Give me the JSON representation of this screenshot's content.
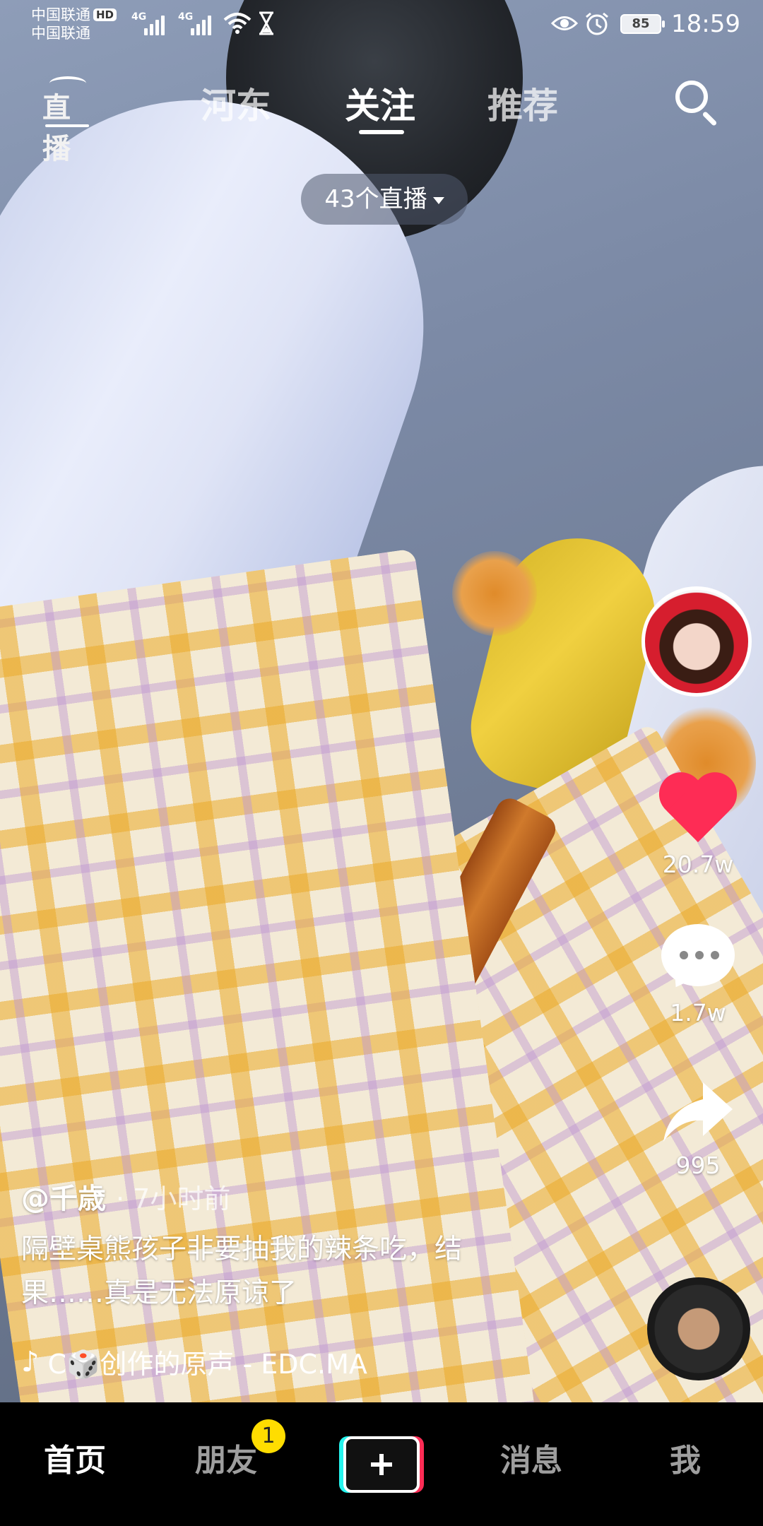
{
  "status_bar": {
    "carrier_1": "中国联通",
    "carrier_2": "中国联通",
    "hd_label": "HD",
    "network_1": "4G",
    "network_2": "4G",
    "battery": "85",
    "time": "18:59"
  },
  "top_tabs": {
    "live_label": "直播",
    "items": [
      "河东",
      "关注",
      "推荐"
    ],
    "active": "关注"
  },
  "live_pill": {
    "label": "43个直播"
  },
  "actions": {
    "like_count": "20.7w",
    "comment_count": "1.7w",
    "share_count": "995"
  },
  "post": {
    "author": "@千歳",
    "time": "· 7小时前",
    "description_line1": "隔壁桌熊孩子非要抽我的辣条吃，结",
    "description_line2": "果……真是无法原谅了",
    "music": "C🎲创作的原声 - EDC.MA"
  },
  "bottom_tabs": {
    "home": "首页",
    "friends": "朋友",
    "friends_badge": "1",
    "messages": "消息",
    "me": "我"
  },
  "colors": {
    "like": "#fe2c55",
    "accent_cyan": "#25f4ee",
    "badge": "#ffdd00"
  }
}
